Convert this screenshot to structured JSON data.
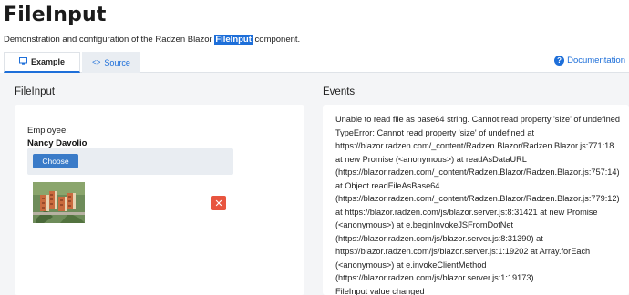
{
  "page": {
    "title": "FileInput",
    "description_before": "Demonstration and configuration of the Radzen Blazor ",
    "description_highlight": "FileInput",
    "description_after": " component."
  },
  "tabs": [
    {
      "label": "Example",
      "icon": "monitor-icon",
      "active": true
    },
    {
      "label": "Source",
      "icon": "code-icon",
      "active": false
    }
  ],
  "documentation_link": {
    "label": "Documentation",
    "icon": "help-circle-icon"
  },
  "fileinput_panel": {
    "title": "FileInput",
    "employee_label": "Employee:",
    "employee_name": "Nancy Davolio",
    "choose_label": "Choose",
    "remove_icon": "close-icon",
    "preview_image": "building-aerial-photo"
  },
  "events_panel": {
    "title": "Events",
    "lines": [
      "Unable to read file as base64 string. Cannot read property 'size' of undefined",
      "TypeError: Cannot read property 'size' of undefined at",
      "https://blazor.radzen.com/_content/Radzen.Blazor/Radzen.Blazor.js:771:18",
      "at new Promise (<anonymous>) at readAsDataURL",
      "(https://blazor.radzen.com/_content/Radzen.Blazor/Radzen.Blazor.js:757:14)",
      "at Object.readFileAsBase64",
      "(https://blazor.radzen.com/_content/Radzen.Blazor/Radzen.Blazor.js:779:12)",
      "at https://blazor.radzen.com/js/blazor.server.js:8:31421 at new Promise",
      "(<anonymous>) at e.beginInvokeJSFromDotNet",
      "(https://blazor.radzen.com/js/blazor.server.js:8:31390) at",
      "https://blazor.radzen.com/js/blazor.server.js:1:19202 at Array.forEach",
      "(<anonymous>) at e.invokeClientMethod",
      "(https://blazor.radzen.com/js/blazor.server.js:1:19173)",
      "FileInput value changed"
    ]
  },
  "colors": {
    "accent": "#1e6fd9",
    "button": "#3a7bc8",
    "danger": "#e8553f",
    "content_bg": "#f4f5f7"
  }
}
